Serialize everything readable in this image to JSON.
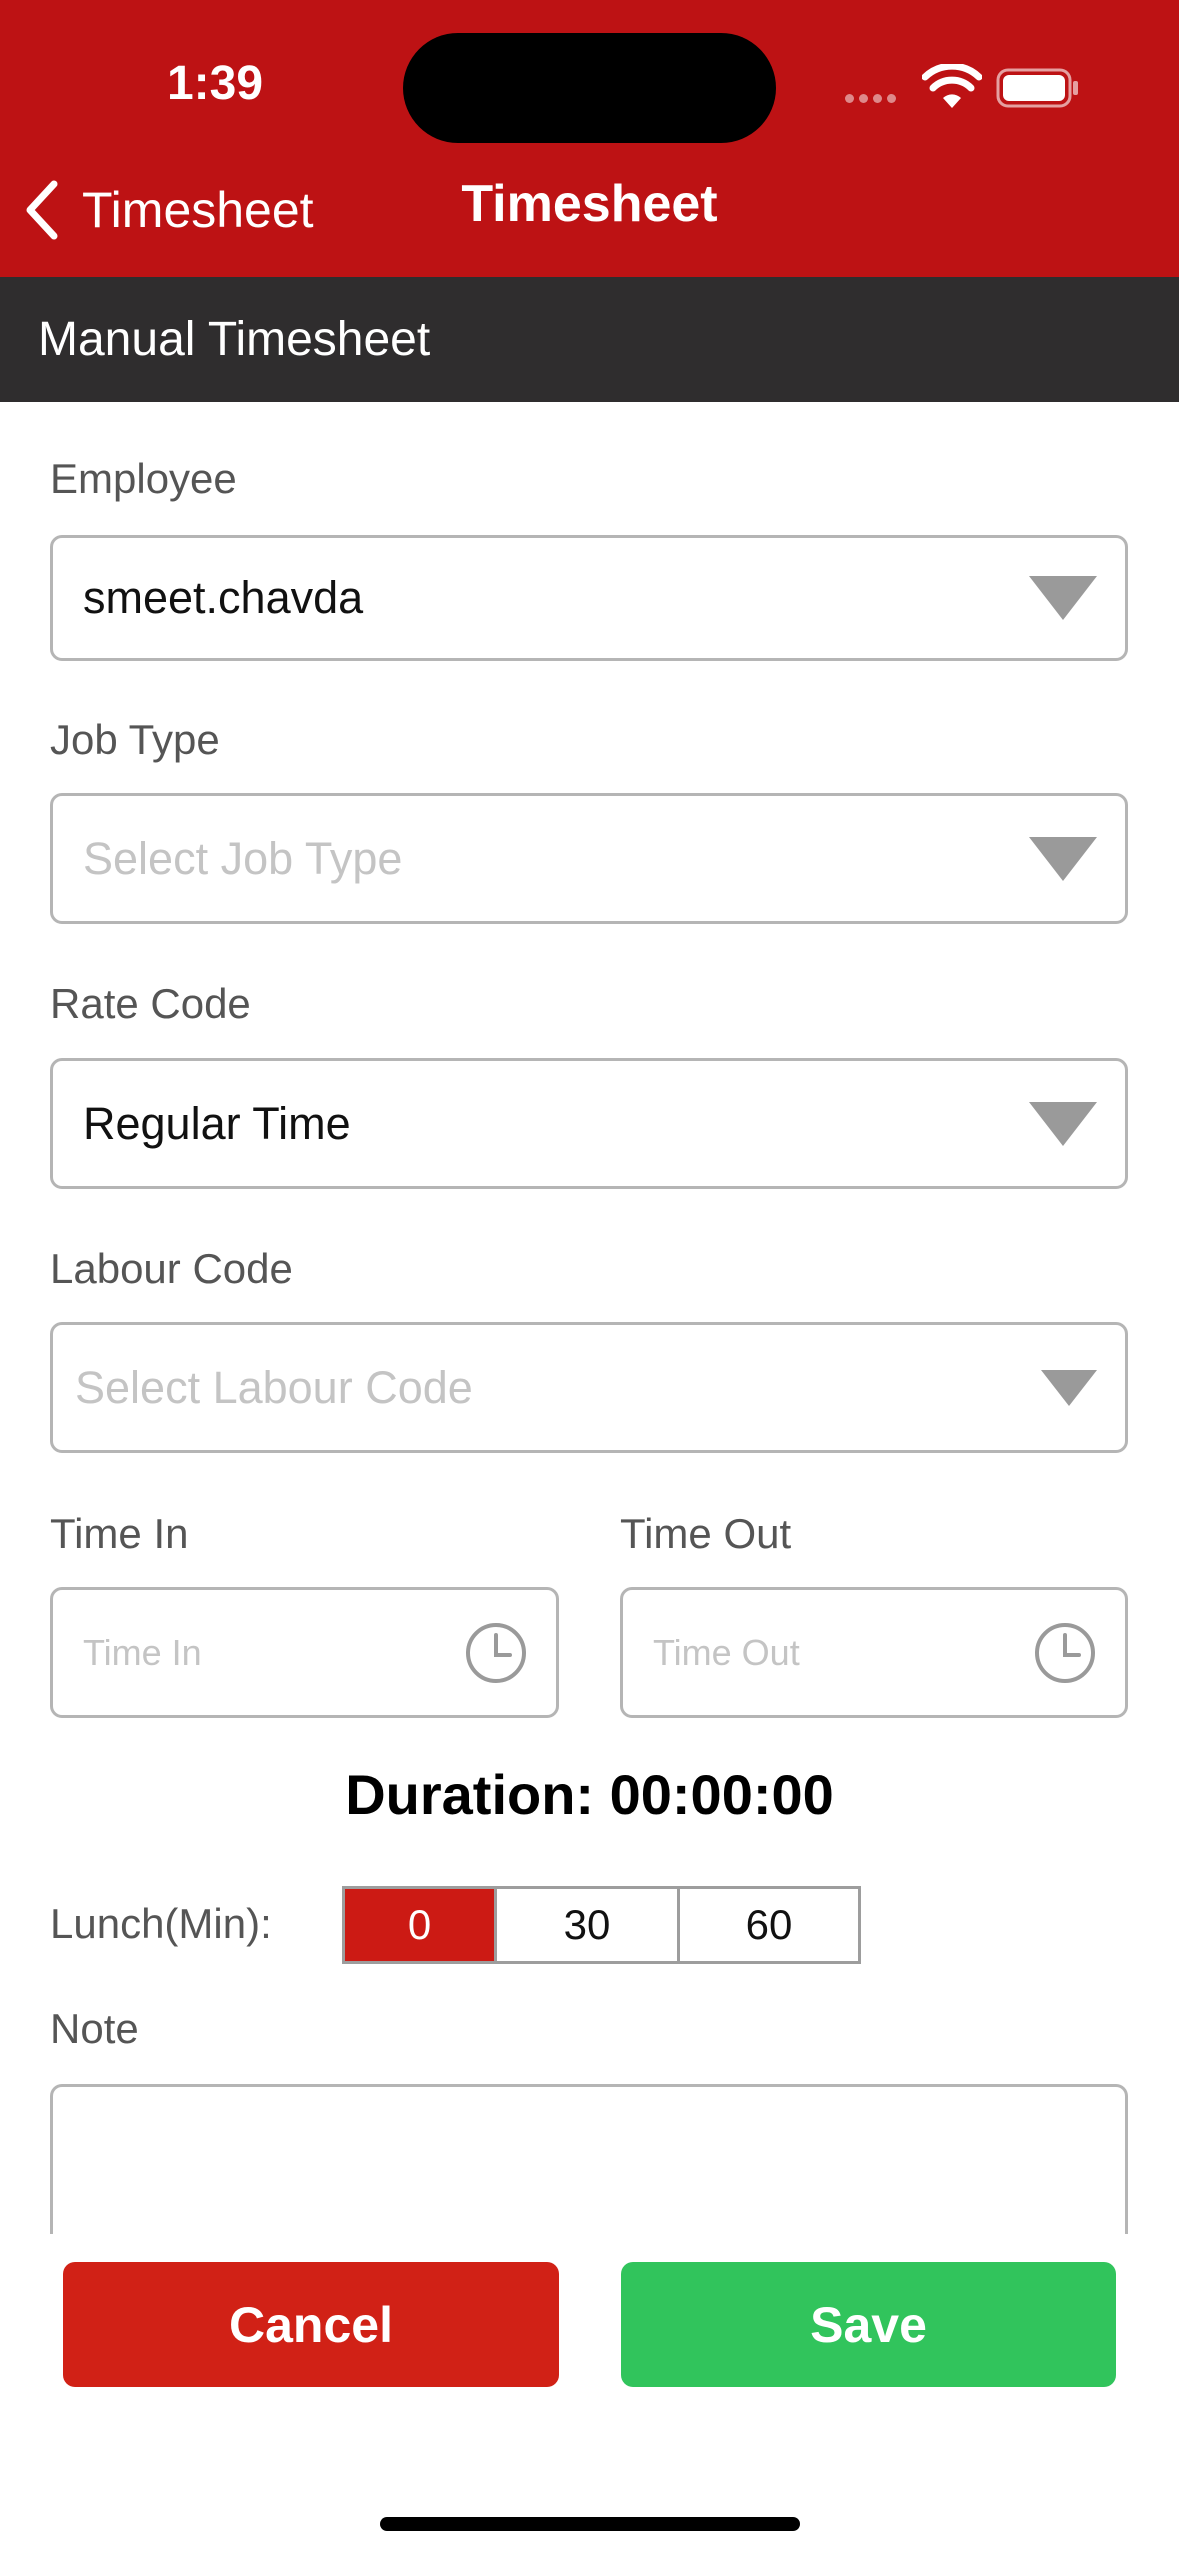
{
  "status_bar": {
    "time": "1:39"
  },
  "nav": {
    "back_label": "Timesheet",
    "title": "Timesheet"
  },
  "section": {
    "title": "Manual Timesheet"
  },
  "form": {
    "employee": {
      "label": "Employee",
      "value": "smeet.chavda"
    },
    "job_type": {
      "label": "Job Type",
      "placeholder": "Select Job Type"
    },
    "rate_code": {
      "label": "Rate Code",
      "value": "Regular Time"
    },
    "labour_code": {
      "label": "Labour Code",
      "placeholder": "Select Labour Code"
    },
    "time_in": {
      "label": "Time In",
      "placeholder": "Time In"
    },
    "time_out": {
      "label": "Time Out",
      "placeholder": "Time Out"
    },
    "duration": "Duration: 00:00:00",
    "lunch": {
      "label": "Lunch(Min):",
      "options": [
        "0",
        "30",
        "60"
      ],
      "selected": "0"
    },
    "note": {
      "label": "Note",
      "value": ""
    }
  },
  "actions": {
    "cancel_label": "Cancel",
    "save_label": "Save"
  },
  "colors": {
    "header": "#bd1214",
    "section_bar": "#2f2d2e",
    "cancel": "#d12116",
    "save": "#31c45c",
    "segment_active": "#cc1a14"
  },
  "icons": {
    "back": "chevron-left-icon",
    "dropdown": "triangle-down-icon",
    "clock": "clock-icon",
    "wifi": "wifi-icon",
    "battery": "battery-icon"
  }
}
